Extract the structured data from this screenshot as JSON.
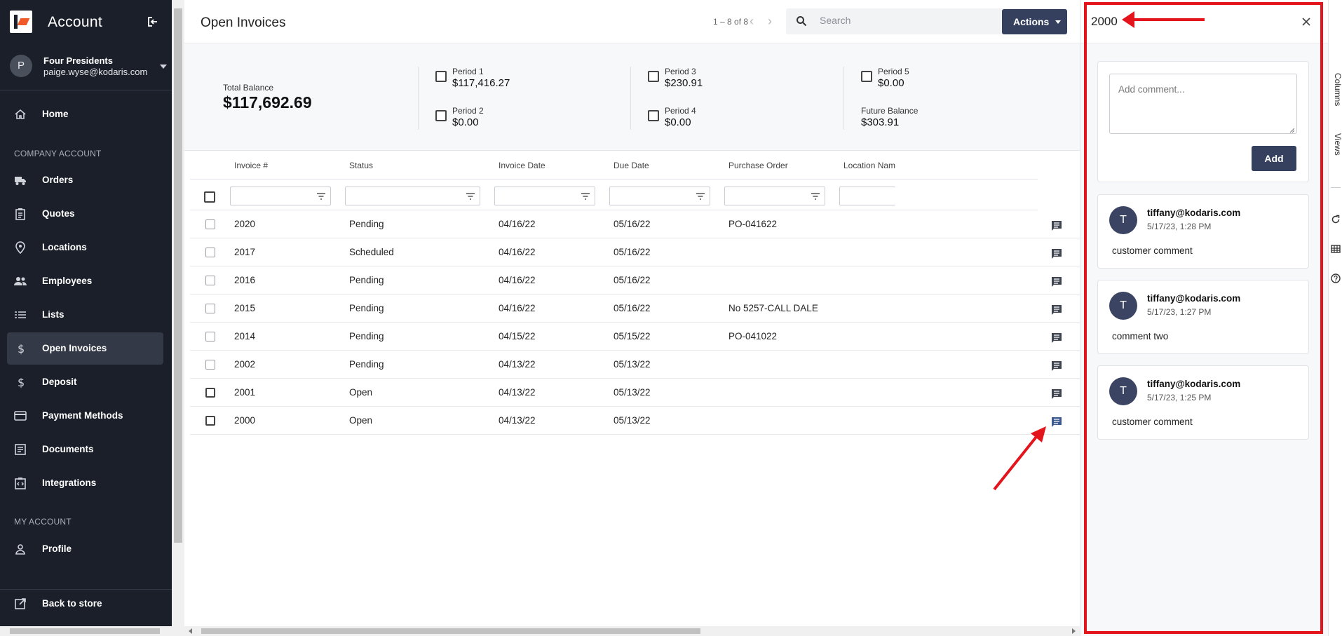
{
  "sidebar": {
    "app_title": "Account",
    "user": {
      "avatar_letter": "P",
      "name": "Four Presidents",
      "email": "paige.wyse@kodaris.com"
    },
    "section_company": "COMPANY ACCOUNT",
    "section_my": "MY ACCOUNT",
    "items": [
      {
        "label": "Home",
        "icon": "home-icon"
      },
      {
        "label": "Orders",
        "icon": "truck-icon"
      },
      {
        "label": "Quotes",
        "icon": "clipboard-icon"
      },
      {
        "label": "Locations",
        "icon": "map-pin-icon"
      },
      {
        "label": "Employees",
        "icon": "people-icon"
      },
      {
        "label": "Lists",
        "icon": "list-icon"
      },
      {
        "label": "Open Invoices",
        "icon": "dollar-icon",
        "active": true
      },
      {
        "label": "Deposit",
        "icon": "dollar-icon"
      },
      {
        "label": "Payment Methods",
        "icon": "credit-card-icon"
      },
      {
        "label": "Documents",
        "icon": "document-icon"
      },
      {
        "label": "Integrations",
        "icon": "integrations-icon"
      },
      {
        "label": "Profile",
        "icon": "person-icon"
      }
    ],
    "back_label": "Back to store"
  },
  "header": {
    "title": "Open Invoices",
    "pager": "1 – 8 of 8",
    "search_placeholder": "Search",
    "actions_label": "Actions"
  },
  "summary": {
    "total_label": "Total Balance",
    "total_value": "$117,692.69",
    "periods": [
      {
        "label": "Period 1",
        "value": "$117,416.27"
      },
      {
        "label": "Period 2",
        "value": "$0.00"
      },
      {
        "label": "Period 3",
        "value": "$230.91"
      },
      {
        "label": "Period 4",
        "value": "$0.00"
      },
      {
        "label": "Period 5",
        "value": "$0.00"
      }
    ],
    "future_label": "Future Balance",
    "future_value": "$303.91"
  },
  "table": {
    "columns": [
      "Invoice #",
      "Status",
      "Invoice Date",
      "Due Date",
      "Purchase Order",
      "Location Nam"
    ],
    "rows": [
      {
        "invoice": "2020",
        "status": "Pending",
        "invoice_date": "04/16/22",
        "due_date": "05/16/22",
        "po": "PO-041622"
      },
      {
        "invoice": "2017",
        "status": "Scheduled",
        "invoice_date": "04/16/22",
        "due_date": "05/16/22",
        "po": ""
      },
      {
        "invoice": "2016",
        "status": "Pending",
        "invoice_date": "04/16/22",
        "due_date": "05/16/22",
        "po": ""
      },
      {
        "invoice": "2015",
        "status": "Pending",
        "invoice_date": "04/16/22",
        "due_date": "05/16/22",
        "po": "No 5257-CALL DALE"
      },
      {
        "invoice": "2014",
        "status": "Pending",
        "invoice_date": "04/15/22",
        "due_date": "05/15/22",
        "po": "PO-041022"
      },
      {
        "invoice": "2002",
        "status": "Pending",
        "invoice_date": "04/13/22",
        "due_date": "05/13/22",
        "po": ""
      },
      {
        "invoice": "2001",
        "status": "Open",
        "invoice_date": "04/13/22",
        "due_date": "05/13/22",
        "po": ""
      },
      {
        "invoice": "2000",
        "status": "Open",
        "invoice_date": "04/13/22",
        "due_date": "05/13/22",
        "po": ""
      }
    ]
  },
  "panel": {
    "title": "2000",
    "comment_placeholder": "Add comment...",
    "add_label": "Add",
    "comments": [
      {
        "avatar": "T",
        "author": "tiffany@kodaris.com",
        "time": "5/17/23, 1:28 PM",
        "text": "customer comment"
      },
      {
        "avatar": "T",
        "author": "tiffany@kodaris.com",
        "time": "5/17/23, 1:27 PM",
        "text": "comment two"
      },
      {
        "avatar": "T",
        "author": "tiffany@kodaris.com",
        "time": "5/17/23, 1:25 PM",
        "text": "customer comment"
      }
    ]
  },
  "rail": {
    "tabs": [
      "Columns",
      "Views"
    ]
  },
  "colors": {
    "sidebar_bg": "#1b1f2a",
    "primary": "#35405e",
    "annotation": "#e3141b"
  }
}
